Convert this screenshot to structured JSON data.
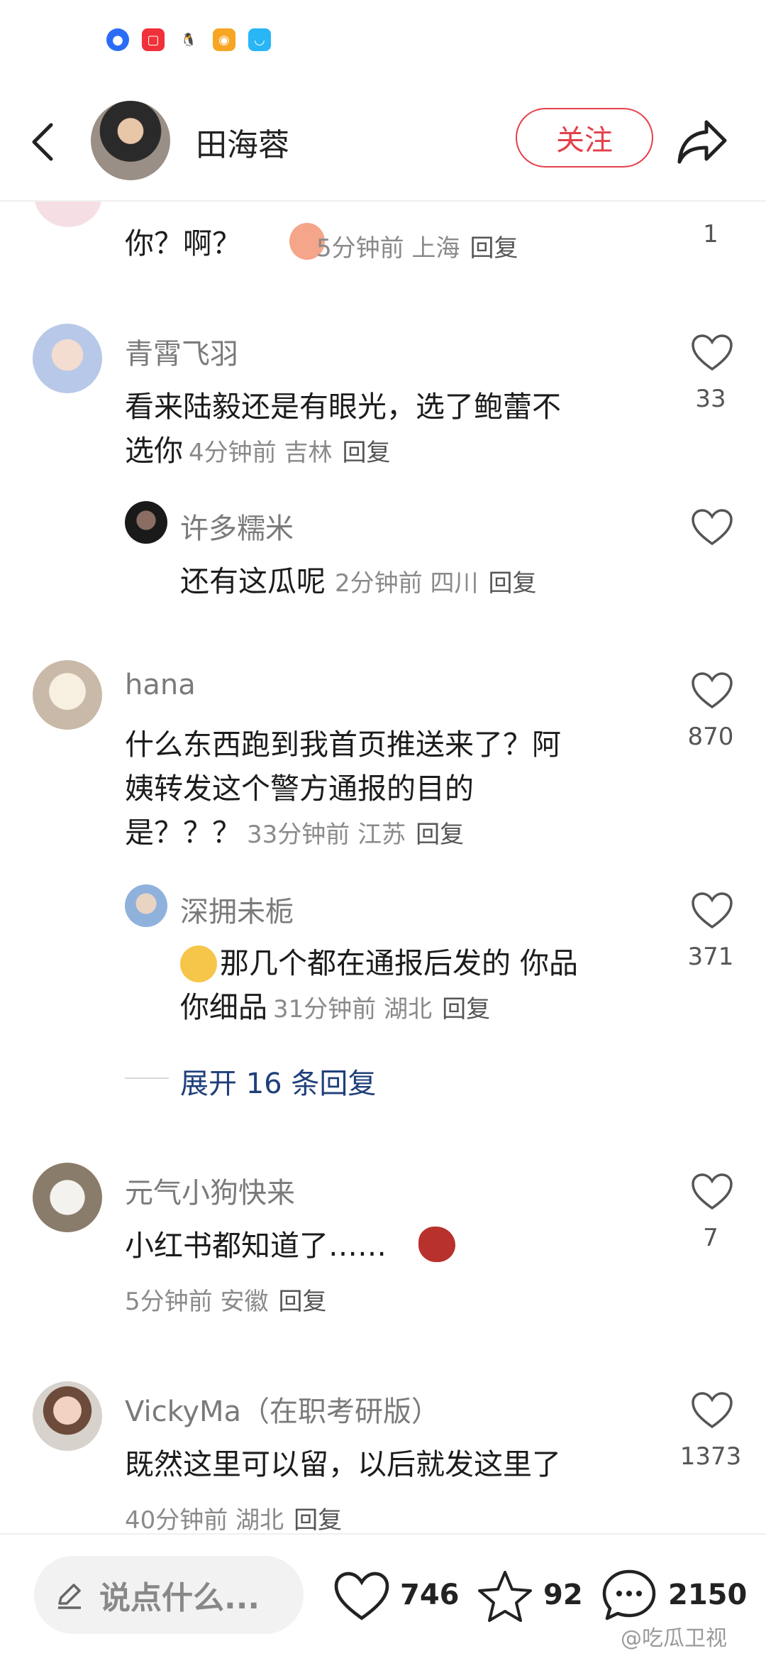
{
  "header": {
    "user_name": "田海蓉",
    "follow_label": "关注"
  },
  "status_icons": [
    "baidu-icon",
    "red-note-icon",
    "qq-icon",
    "weibo-icon",
    "shop-icon"
  ],
  "partial_comment": {
    "text": "你？啊？",
    "time": "5分钟前",
    "location": "上海",
    "reply_label": "回复",
    "like_count": "1"
  },
  "comments": [
    {
      "name": "青霄飞羽",
      "text_lines": [
        "看来陆毅还是有眼光，选了鲍蕾不",
        "选你"
      ],
      "time": "4分钟前",
      "location": "吉林",
      "reply_label": "回复",
      "like_count": "33",
      "sub_reply": {
        "name": "许多糯米",
        "text": "还有这瓜呢",
        "time": "2分钟前",
        "location": "四川",
        "reply_label": "回复",
        "like_count": ""
      }
    },
    {
      "name": "hana",
      "text_lines": [
        "什么东西跑到我首页推送来了？阿",
        "姨转发这个警方通报的目的",
        "是？？？"
      ],
      "time": "33分钟前",
      "location": "江苏",
      "reply_label": "回复",
      "like_count": "870",
      "sub_reply": {
        "name": "深拥未栀",
        "text_lines": [
          "那几个都在通报后发的 你品",
          "你细品"
        ],
        "time": "31分钟前",
        "location": "湖北",
        "reply_label": "回复",
        "like_count": "371"
      },
      "expand_label": "展开 16 条回复"
    },
    {
      "name": "元气小狗快来",
      "text": "小红书都知道了……",
      "time": "5分钟前",
      "location": "安徽",
      "reply_label": "回复",
      "like_count": "7"
    },
    {
      "name": "VickyMa（在职考研版）",
      "text": "既然这里可以留，以后就发这里了",
      "time": "40分钟前",
      "location": "湖北",
      "reply_label": "回复",
      "like_count": "1373"
    }
  ],
  "bottom_bar": {
    "input_placeholder": "说点什么...",
    "like_count": "746",
    "star_count": "92",
    "comment_count": "2150"
  },
  "watermark": "@吃瓜卫视",
  "colors": {
    "accent": "#e5404b",
    "link": "#1f3f7a"
  }
}
